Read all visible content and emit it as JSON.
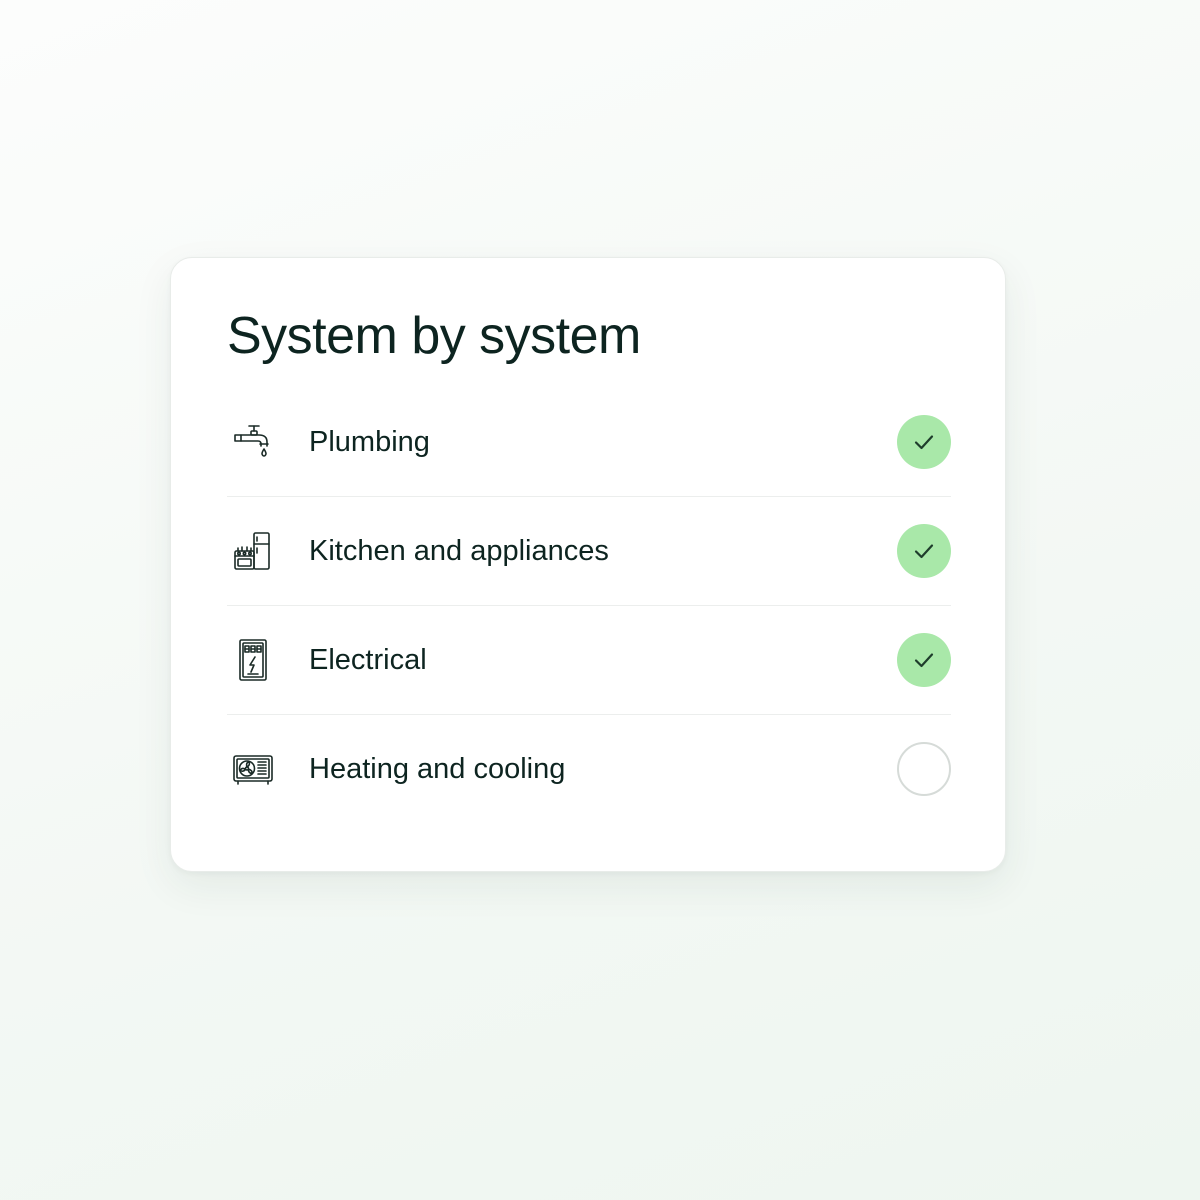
{
  "card": {
    "title": "System by system",
    "items": [
      {
        "label": "Plumbing",
        "icon": "faucet-icon",
        "status": "complete"
      },
      {
        "label": "Kitchen and appliances",
        "icon": "stove-fridge-icon",
        "status": "complete"
      },
      {
        "label": "Electrical",
        "icon": "electrical-panel-icon",
        "status": "complete"
      },
      {
        "label": "Heating and cooling",
        "icon": "ac-unit-icon",
        "status": "incomplete"
      }
    ]
  },
  "colors": {
    "text": "#0d2420",
    "check_fill": "#a9e8a9",
    "pending_border": "#d6dbd8",
    "divider": "#eceeed"
  }
}
